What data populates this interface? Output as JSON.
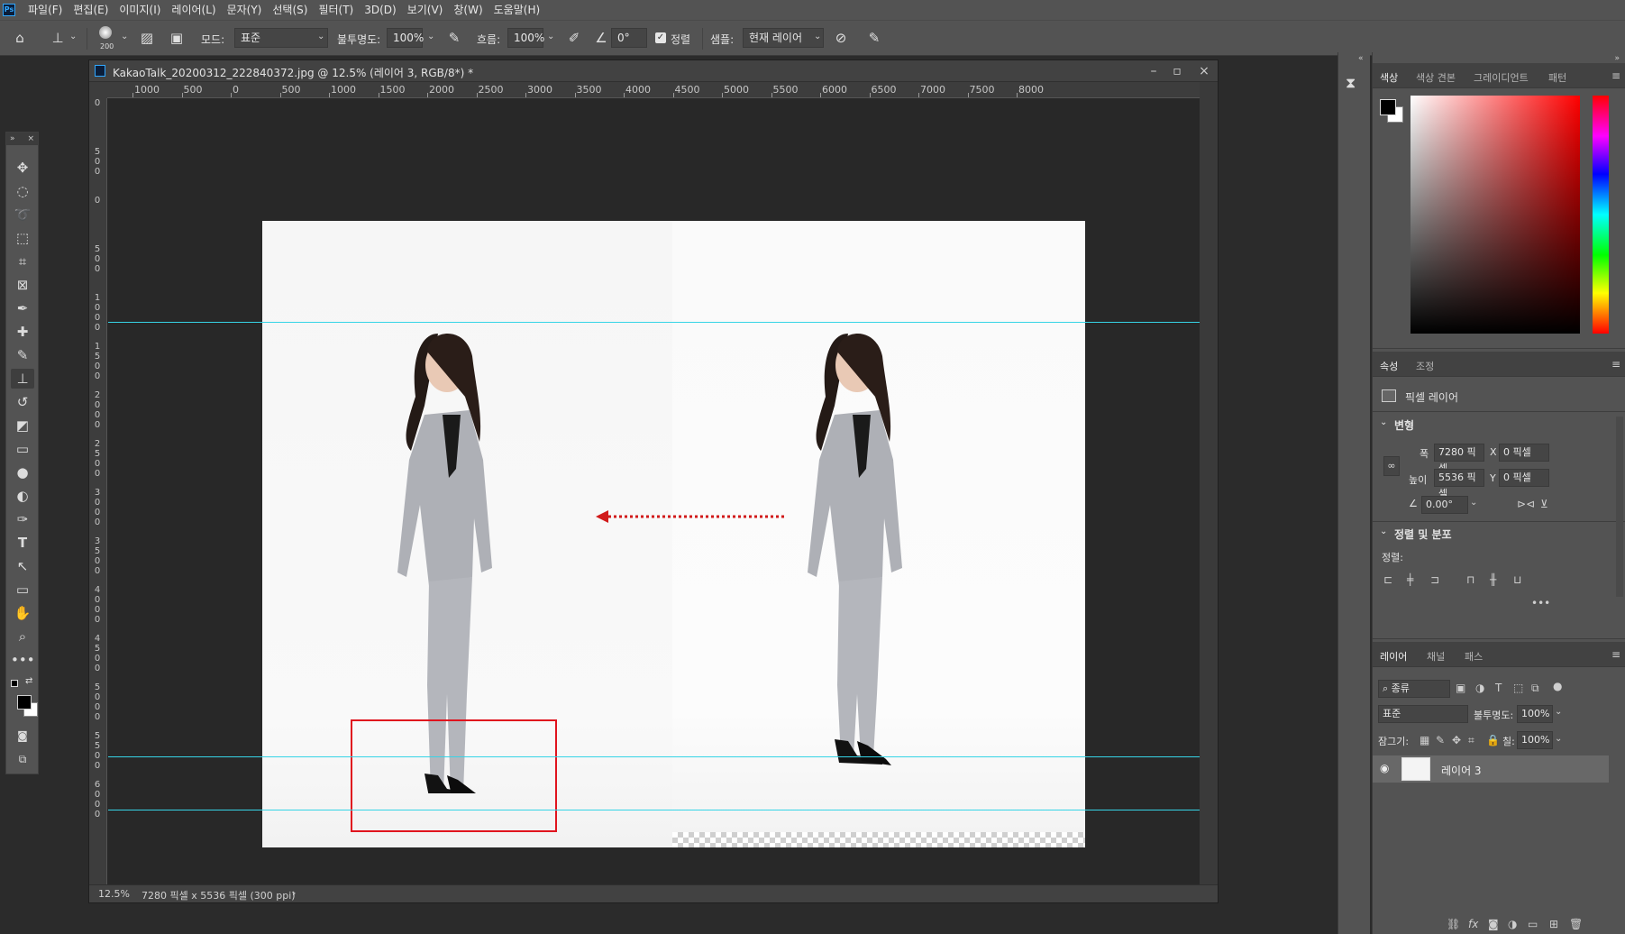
{
  "menu": {
    "logo": "Ps",
    "items": [
      "파일(F)",
      "편집(E)",
      "이미지(I)",
      "레이어(L)",
      "문자(Y)",
      "선택(S)",
      "필터(T)",
      "3D(D)",
      "보기(V)",
      "창(W)",
      "도움말(H)"
    ]
  },
  "options": {
    "brush_size": "200",
    "mode_label": "모드:",
    "mode_value": "표준",
    "opacity_label": "불투명도:",
    "opacity_value": "100%",
    "flow_label": "흐름:",
    "flow_value": "100%",
    "angle_value": "0°",
    "aligned_label": "정렬",
    "sample_label": "샘플:",
    "sample_value": "현재 레이어"
  },
  "document": {
    "title": "KakaoTalk_20200312_222840372.jpg @ 12.5% (레이어 3, RGB/8*) *",
    "zoom": "12.5%",
    "info": "7280 픽셀 x 5536 픽셀 (300 ppi)",
    "ruler_top_labels": [
      "1000",
      "500",
      "0",
      "500",
      "1000",
      "1500",
      "2000",
      "2500",
      "3000",
      "3500",
      "4000",
      "4500",
      "5000",
      "5500",
      "6000",
      "6500",
      "7000",
      "7500",
      "8000"
    ],
    "ruler_left_labels": [
      "0",
      "500",
      "0",
      "500",
      "1000",
      "1500",
      "2000",
      "2500",
      "3000",
      "3500",
      "4000",
      "4500",
      "5000",
      "5500",
      "6000"
    ]
  },
  "color_panel": {
    "tabs": [
      "색상",
      "색상 견본",
      "그레이디언트",
      "패턴"
    ],
    "hue_color": "#ff0000"
  },
  "properties_panel": {
    "tabs": [
      "속성",
      "조정"
    ],
    "layer_type": "픽셀 레이어",
    "transform_header": "변형",
    "width_label": "폭",
    "width_value": "7280 픽셀",
    "height_label": "높이",
    "height_value": "5536 픽셀",
    "x_label": "X",
    "x_value": "0 픽셀",
    "y_label": "Y",
    "y_value": "0 픽셀",
    "angle_value": "0.00°",
    "align_header": "정렬 및 분포",
    "align_label": "정렬:"
  },
  "layers_panel": {
    "tabs": [
      "레이어",
      "채널",
      "패스"
    ],
    "filter_label": "종류",
    "blend_mode": "표준",
    "opacity_label": "불투명도:",
    "opacity_value": "100%",
    "lock_label": "잠그기:",
    "fill_label": "칠:",
    "fill_value": "100%",
    "layers": [
      {
        "name": "레이어 3",
        "visible": true
      }
    ]
  },
  "colors": {
    "guide": "#36d4e6",
    "selection": "#e0141e",
    "arrow": "#d11a1a",
    "foreground": "#000000",
    "background": "#ffffff"
  }
}
